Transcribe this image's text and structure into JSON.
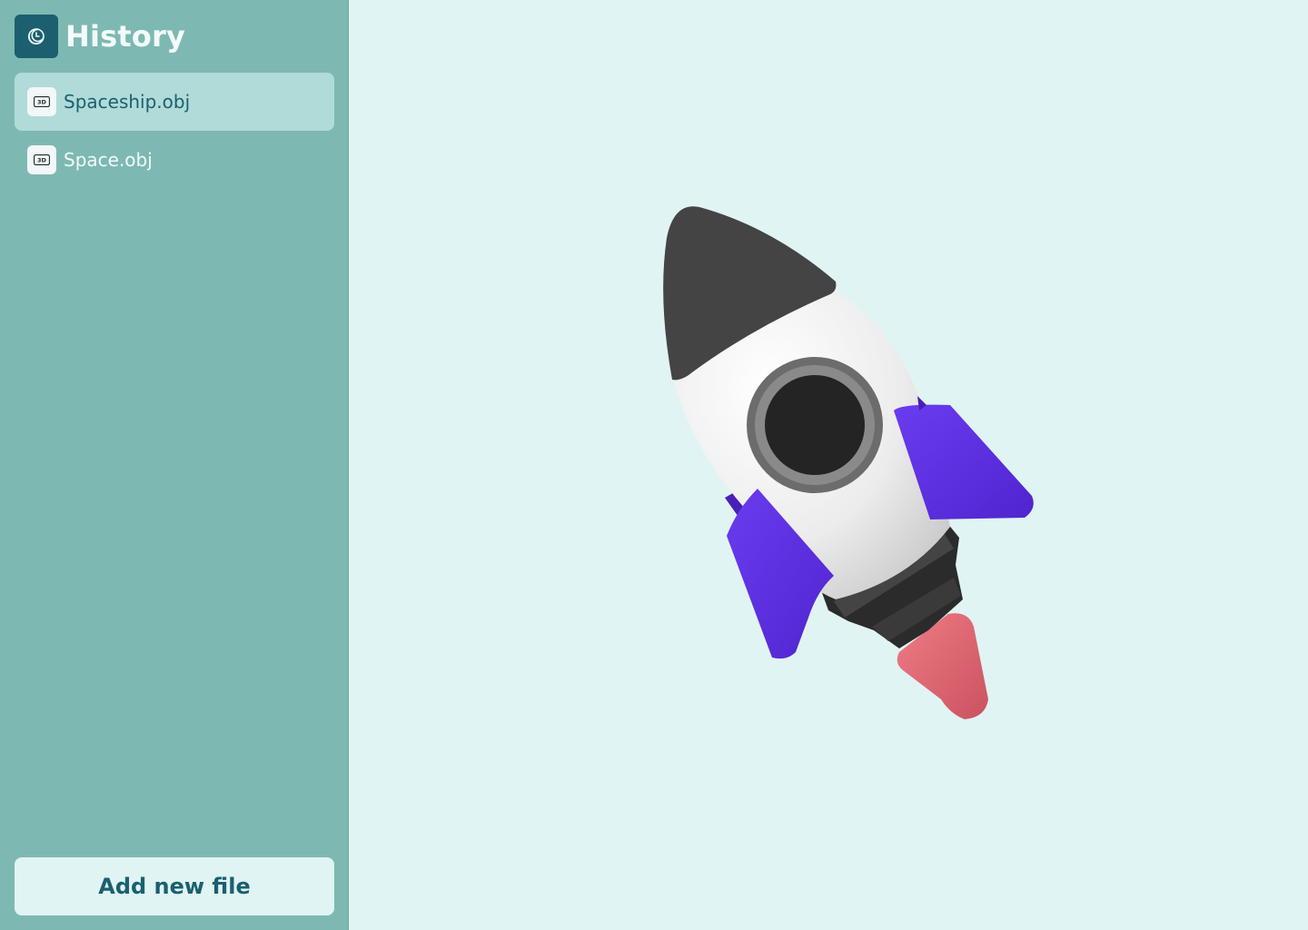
{
  "sidebar": {
    "title": "History",
    "header_icon": "history-clock-icon",
    "files": [
      {
        "name": "Spaceship.obj",
        "icon": "3d-file-icon",
        "selected": true
      },
      {
        "name": "Space.obj",
        "icon": "3d-file-icon",
        "selected": false
      }
    ],
    "add_button_label": "Add new file"
  },
  "viewer": {
    "model": "rocket",
    "background": "#e0f4f3"
  },
  "colors": {
    "sidebar_bg": "#7db9b2",
    "accent": "#1b5f70",
    "selected_bg": "#b0dbd8",
    "rocket_fins": "#5b2ee0",
    "rocket_flame": "#e56f7a"
  }
}
